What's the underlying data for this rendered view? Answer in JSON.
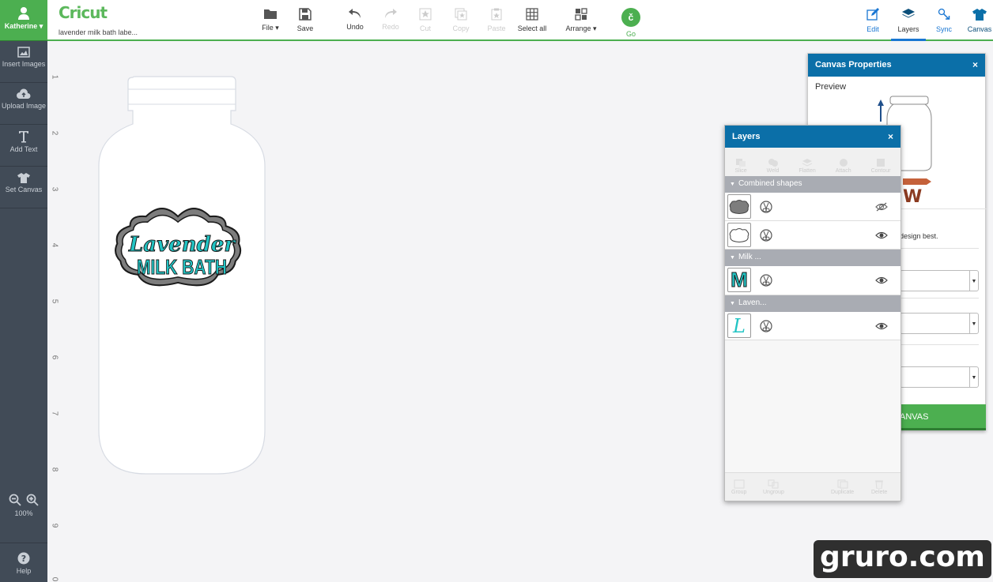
{
  "sidebar": {
    "user": "Katherine",
    "items": [
      {
        "label": "Insert Images",
        "icon": "image-icon"
      },
      {
        "label": "Upload Image",
        "icon": "cloud-upload-icon"
      },
      {
        "label": "Add Text",
        "icon": "text-icon"
      },
      {
        "label": "Set Canvas",
        "icon": "shirt-icon"
      }
    ],
    "zoom": "100%",
    "help": "Help"
  },
  "header": {
    "brand": "Cricut",
    "project": "lavender milk bath labe...",
    "file": "File",
    "save": "Save",
    "undo": "Undo",
    "redo": "Redo",
    "cut": "Cut",
    "copy": "Copy",
    "paste": "Paste",
    "select_all": "Select all",
    "arrange": "Arrange",
    "go": "Go",
    "right_tabs": {
      "edit": "Edit",
      "layers": "Layers",
      "sync": "Sync",
      "canvas": "Canvas"
    }
  },
  "ruler": [
    "1",
    "2",
    "3",
    "4",
    "5",
    "6",
    "7",
    "8",
    "9",
    "0"
  ],
  "design": {
    "line1": "Lavender",
    "line2": "MILK BATH",
    "colors": {
      "teal": "#22c4c4",
      "outline": "#7d7d7d",
      "dark": "#1a1a1a"
    }
  },
  "canvas_panel": {
    "title": "Canvas Properties",
    "close": "×",
    "preview": "Preview",
    "preview_letter": "W",
    "hint": "design best.",
    "button": "ANVAS"
  },
  "layers_panel": {
    "title": "Layers",
    "close": "×",
    "tools": [
      "Slice",
      "Weld",
      "Flatten",
      "Attach",
      "Contour"
    ],
    "groups": [
      {
        "name": "Combined shapes"
      },
      {
        "name": "Milk ..."
      },
      {
        "name": "Laven..."
      }
    ],
    "thumb_m": "M",
    "thumb_l": "L",
    "bottom_tools": [
      "Group",
      "Ungroup",
      "Duplicate",
      "Delete"
    ]
  },
  "watermark": "gruro.com",
  "colors": {
    "green": "#4caf50",
    "blue": "#0b6fa8",
    "sidebar": "#414b57"
  }
}
